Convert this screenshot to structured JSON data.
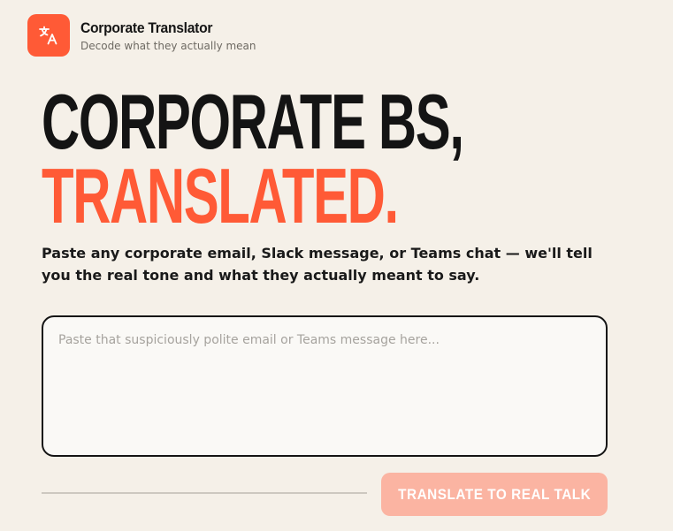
{
  "app": {
    "title": "Corporate Translator",
    "subtitle": "Decode what they actually mean",
    "logo_icon": "translate-icon",
    "accent_color": "#ff5a36"
  },
  "hero": {
    "line1": "CORPORATE BS,",
    "line2": "TRANSLATED."
  },
  "description": "Paste any corporate email, Slack message, or Teams chat — we'll tell you the real tone and what they actually meant to say.",
  "input": {
    "value": "",
    "placeholder": "Paste that suspiciously polite email or Teams message here..."
  },
  "actions": {
    "translate_label": "TRANSLATE TO REAL TALK",
    "translate_disabled_color": "#fbb4a2"
  }
}
